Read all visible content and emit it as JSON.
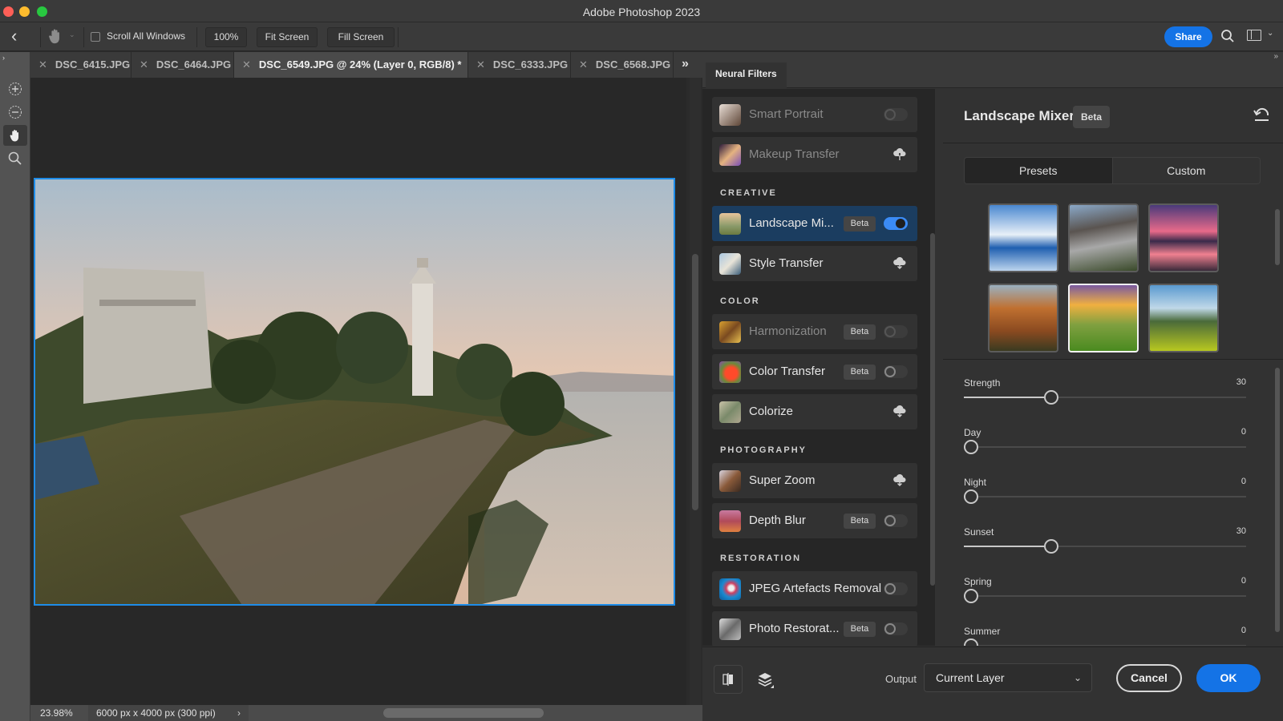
{
  "window": {
    "title": "Adobe Photoshop 2023"
  },
  "options_bar": {
    "scroll_all_windows": {
      "label": "Scroll All Windows",
      "checked": false
    },
    "zoom_100": "100%",
    "fit_screen": "Fit Screen",
    "fill_screen": "Fill Screen",
    "share": "Share"
  },
  "tabs": [
    {
      "label": "DSC_6415.JPG",
      "active": false
    },
    {
      "label": "DSC_6464.JPG",
      "active": false
    },
    {
      "label": "DSC_6549.JPG @ 24% (Layer 0, RGB/8) *",
      "active": true
    },
    {
      "label": "DSC_6333.JPG",
      "active": false
    },
    {
      "label": "DSC_6568.JPG",
      "active": false
    }
  ],
  "tabs_overflow": "»",
  "tools": [
    "zoom-in-icon",
    "zoom-out-icon",
    "hand-icon",
    "zoom-icon"
  ],
  "status": {
    "zoom": "23.98%",
    "doc_info": "6000 px x 4000 px (300 ppi)",
    "arrow": "›"
  },
  "neural_filters": {
    "panel_title": "Neural Filters",
    "featured": [
      {
        "label": "Smart Portrait",
        "dim": true,
        "control": "toggle",
        "on": false,
        "beta": false
      },
      {
        "label": "Makeup Transfer",
        "dim": true,
        "control": "download",
        "beta": false
      }
    ],
    "sections": [
      {
        "title": "CREATIVE",
        "items": [
          {
            "label": "Landscape Mi...",
            "beta": true,
            "control": "toggle",
            "on": true,
            "selected": true
          },
          {
            "label": "Style Transfer",
            "beta": false,
            "control": "download"
          }
        ]
      },
      {
        "title": "COLOR",
        "items": [
          {
            "label": "Harmonization",
            "beta": true,
            "control": "toggle",
            "on": false,
            "dim": true
          },
          {
            "label": "Color Transfer",
            "beta": true,
            "control": "toggle",
            "on": false
          },
          {
            "label": "Colorize",
            "beta": false,
            "control": "download"
          }
        ]
      },
      {
        "title": "PHOTOGRAPHY",
        "items": [
          {
            "label": "Super Zoom",
            "beta": false,
            "control": "download"
          },
          {
            "label": "Depth Blur",
            "beta": true,
            "control": "toggle",
            "on": false
          }
        ]
      },
      {
        "title": "RESTORATION",
        "items": [
          {
            "label": "JPEG Artefacts Removal",
            "beta": false,
            "control": "toggle",
            "on": false
          },
          {
            "label": "Photo Restorat...",
            "beta": true,
            "control": "toggle",
            "on": false
          }
        ]
      }
    ],
    "beta_label": "Beta",
    "detail": {
      "title": "Landscape Mixer",
      "badge": "Beta",
      "tabs": [
        {
          "label": "Presets",
          "active": true
        },
        {
          "label": "Custom",
          "active": false
        }
      ],
      "presets": [
        {
          "name": "winter-lake",
          "selected": false
        },
        {
          "name": "mountain-valley",
          "selected": false
        },
        {
          "name": "purple-sunset-peak",
          "selected": false
        },
        {
          "name": "canyon",
          "selected": false
        },
        {
          "name": "sunrise-meadow",
          "selected": true
        },
        {
          "name": "spring-field",
          "selected": false
        }
      ],
      "sliders": [
        {
          "label": "Strength",
          "value": 30,
          "max": 100
        },
        {
          "label": "Day",
          "value": 0,
          "max": 100
        },
        {
          "label": "Night",
          "value": 0,
          "max": 100
        },
        {
          "label": "Sunset",
          "value": 30,
          "max": 100
        },
        {
          "label": "Spring",
          "value": 0,
          "max": 100
        },
        {
          "label": "Summer",
          "value": 0,
          "max": 100
        }
      ]
    },
    "footer": {
      "output_label": "Output",
      "output_value": "Current Layer",
      "cancel": "Cancel",
      "ok": "OK"
    }
  },
  "colors": {
    "accent": "#1473e6",
    "selection_border": "#1e8ce8",
    "toggle_on": "#3b8bf5",
    "selected_row": "#1b3d60"
  }
}
